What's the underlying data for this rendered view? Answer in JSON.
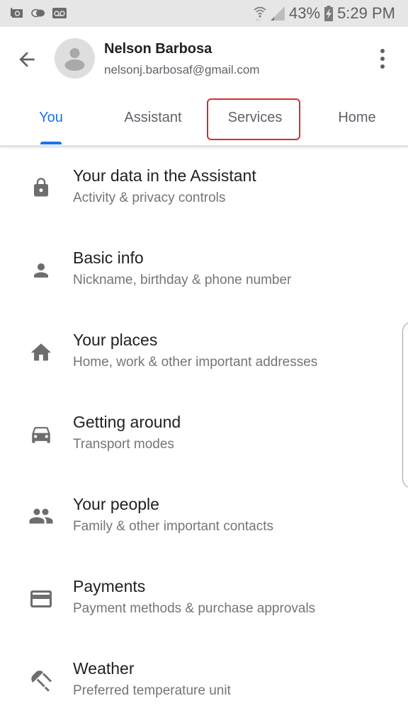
{
  "status_bar": {
    "left_icons": [
      "screenshot-icon",
      "dw-app-icon",
      "voicemail-icon"
    ],
    "battery_percent": "43%",
    "time": "5:29 PM"
  },
  "header": {
    "back_icon": "arrow-back-icon",
    "account_name": "Nelson Barbosa",
    "account_email": "nelsonj.barbosaf@gmail.com",
    "more_icon": "more-vert-icon"
  },
  "tabs": [
    {
      "label": "You",
      "active": true
    },
    {
      "label": "Assistant",
      "active": false
    },
    {
      "label": "Services",
      "active": false,
      "highlighted": true
    },
    {
      "label": "Home",
      "active": false
    }
  ],
  "colors": {
    "accent": "#1a73e8",
    "highlight_box": "#d32f2f",
    "icon_gray": "#6d6d6d",
    "title_text": "#212121",
    "subtitle_text": "#757575"
  },
  "settings_items": [
    {
      "icon": "lock-icon",
      "title": "Your data in the Assistant",
      "subtitle": "Activity & privacy controls"
    },
    {
      "icon": "person-icon",
      "title": "Basic info",
      "subtitle": "Nickname, birthday & phone number"
    },
    {
      "icon": "home-icon",
      "title": "Your places",
      "subtitle": "Home, work & other important addresses"
    },
    {
      "icon": "car-icon",
      "title": "Getting around",
      "subtitle": "Transport modes"
    },
    {
      "icon": "people-icon",
      "title": "Your people",
      "subtitle": "Family & other important contacts"
    },
    {
      "icon": "credit-card-icon",
      "title": "Payments",
      "subtitle": "Payment methods & purchase approvals"
    },
    {
      "icon": "umbrella-icon",
      "title": "Weather",
      "subtitle": "Preferred temperature unit"
    }
  ]
}
